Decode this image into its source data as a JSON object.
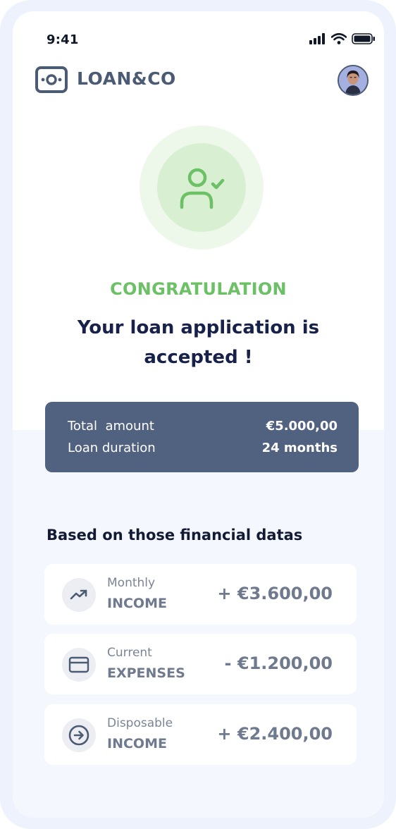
{
  "status_bar": {
    "time": "9:41"
  },
  "header": {
    "brand": "LOAN&CO"
  },
  "hero": {
    "headline": "CONGRATULATION",
    "message": "Your loan application is accepted !"
  },
  "summary": {
    "rows": [
      {
        "label": "Total  amount",
        "value": "€5.000,00"
      },
      {
        "label": "Loan duration",
        "value": "24 months"
      }
    ]
  },
  "financials": {
    "title": "Based on those financial datas",
    "items": [
      {
        "caption": "Monthly",
        "label": "INCOME",
        "value": "+ €3.600,00",
        "icon": "trending-up-icon"
      },
      {
        "caption": "Current",
        "label": "EXPENSES",
        "value": "- €1.200,00",
        "icon": "credit-card-icon"
      },
      {
        "caption": "Disposable",
        "label": "INCOME",
        "value": "+ €2.400,00",
        "icon": "arrow-circle-right-icon"
      }
    ]
  },
  "colors": {
    "accent_green": "#6cc066",
    "navy": "#17214a",
    "card_slate": "#516180"
  }
}
